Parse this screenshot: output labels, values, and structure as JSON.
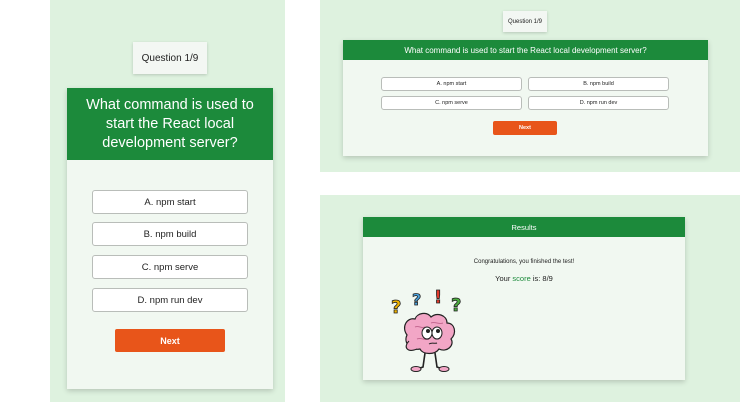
{
  "quiz": {
    "question_counter": "Question 1/9",
    "question": "What command is used to start the React local development server?",
    "options": [
      {
        "label": "A. npm start"
      },
      {
        "label": "B. npm build"
      },
      {
        "label": "C. npm serve"
      },
      {
        "label": "D. npm run dev"
      }
    ],
    "next_label": "Next"
  },
  "results": {
    "title": "Results",
    "congrats": "Congratulations, you finished the test!",
    "score_prefix": "Your ",
    "score_word": "score",
    "score_suffix": " is: 8/9"
  },
  "colors": {
    "panel_bg": "#def2df",
    "header_green": "#1c8a3b",
    "next_orange": "#e8551a",
    "score_green": "#1c8a3b"
  },
  "icons": {
    "results_illustration": "confused-brain-icon"
  }
}
